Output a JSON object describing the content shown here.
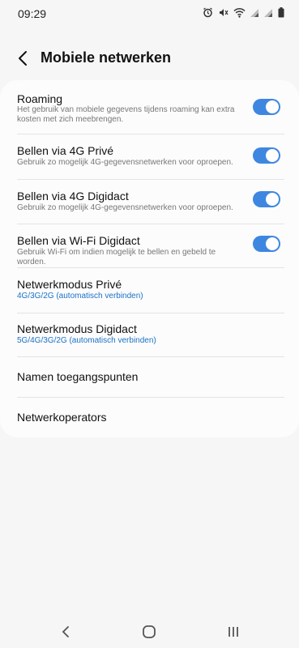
{
  "status_bar": {
    "time": "09:29",
    "icons": [
      "alarm-icon",
      "mute-icon",
      "wifi-icon",
      "signal-icon",
      "signal-icon",
      "battery-icon"
    ]
  },
  "app_bar": {
    "title": "Mobiele netwerken"
  },
  "settings": [
    {
      "title": "Roaming",
      "subtitle": "Het gebruik van mobiele gegevens tijdens roaming kan extra kosten met zich meebrengen.",
      "toggle": true
    },
    {
      "title": "Bellen via 4G Privé",
      "subtitle": "Gebruik zo mogelijk 4G-gegevensnetwerken voor oproepen.",
      "toggle": true
    },
    {
      "title": "Bellen via 4G Digidact",
      "subtitle": "Gebruik zo mogelijk 4G-gegevensnetwerken voor oproepen.",
      "toggle": true
    },
    {
      "title": "Bellen via Wi-Fi Digidact",
      "subtitle": "Gebruik Wi-Fi om indien mogelijk te bellen en gebeld te worden.",
      "toggle": true
    },
    {
      "title": "Netwerkmodus Privé",
      "subtitle": "4G/3G/2G (automatisch verbinden)",
      "toggle": null
    },
    {
      "title": "Netwerkmodus Digidact",
      "subtitle": "5G/4G/3G/2G (automatisch verbinden)",
      "toggle": null
    },
    {
      "title": "Namen toegangspunten",
      "subtitle": "",
      "toggle": null
    },
    {
      "title": "Netwerkoperators",
      "subtitle": "",
      "toggle": null
    }
  ],
  "colors": {
    "accent": "#3e87e0",
    "link": "#1a72c7",
    "background": "#f6f6f6",
    "card": "#fcfcfc"
  },
  "nav_bar": [
    "back-nav-icon",
    "home-nav-icon",
    "recents-nav-icon"
  ]
}
